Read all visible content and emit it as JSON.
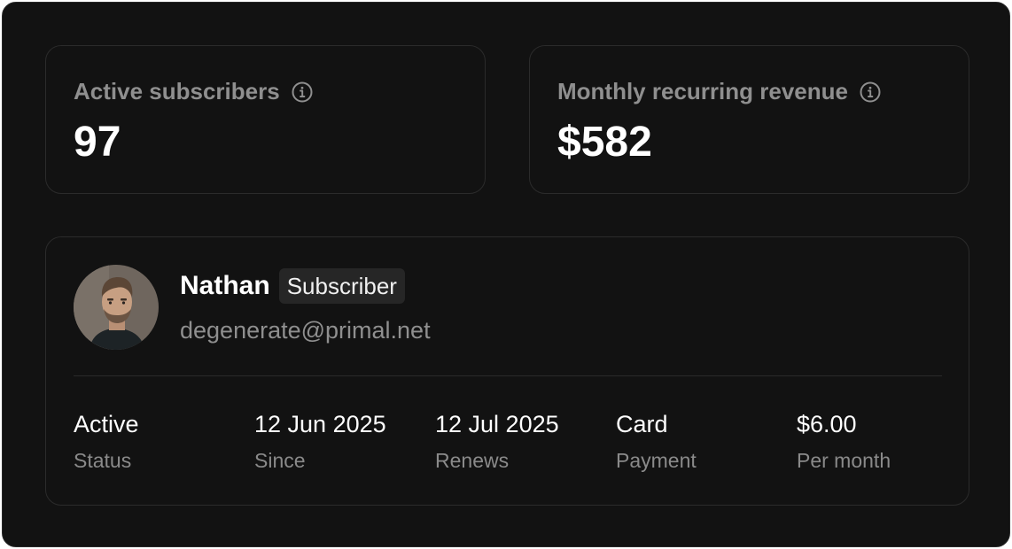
{
  "stats": [
    {
      "label": "Active subscribers",
      "value": "97",
      "icon": "info-icon"
    },
    {
      "label": "Monthly recurring revenue",
      "value": "$582",
      "icon": "info-icon"
    }
  ],
  "subscriber": {
    "name": "Nathan",
    "badge": "Subscriber",
    "email": "degenerate@primal.net",
    "details": [
      {
        "value": "Active",
        "label": "Status"
      },
      {
        "value": "12 Jun 2025",
        "label": "Since"
      },
      {
        "value": "12 Jul 2025",
        "label": "Renews"
      },
      {
        "value": "Card",
        "label": "Payment"
      },
      {
        "value": "$6.00",
        "label": "Per month"
      }
    ]
  },
  "colors": {
    "background": "#121212",
    "border": "#2b2b2b",
    "text_primary": "#ffffff",
    "text_muted": "#8f8f8f",
    "badge_bg": "#262626"
  }
}
